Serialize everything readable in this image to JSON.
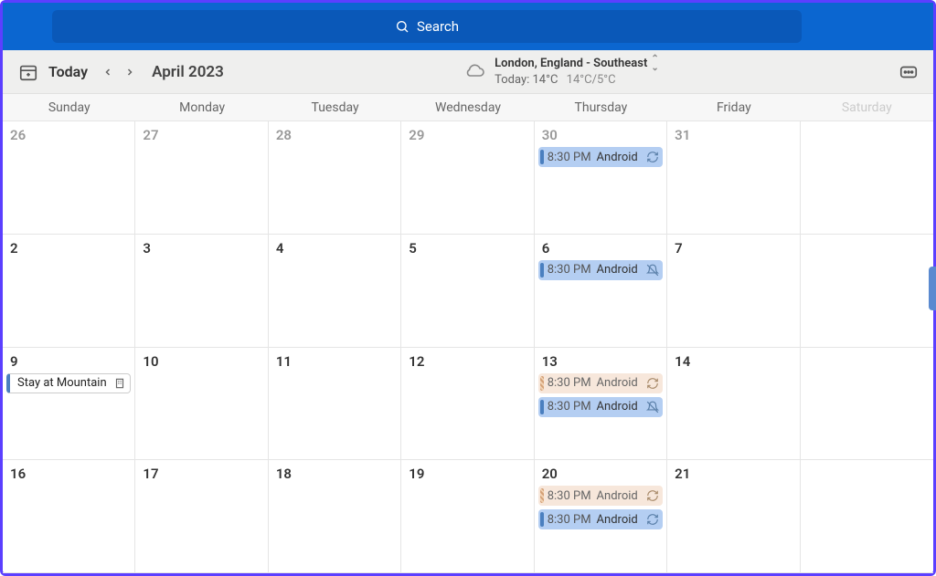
{
  "search": {
    "placeholder": "Search"
  },
  "toolbar": {
    "today_label": "Today",
    "month_label": "April 2023"
  },
  "weather": {
    "location": "London, England - Southeast",
    "today_prefix": "Today:",
    "current": "14°C",
    "high_low": "14°C/5°C"
  },
  "days": [
    "Sunday",
    "Monday",
    "Tuesday",
    "Wednesday",
    "Thursday",
    "Friday",
    "Saturday"
  ],
  "cells": [
    {
      "d": "26",
      "muted": true,
      "events": []
    },
    {
      "d": "27",
      "muted": true,
      "events": []
    },
    {
      "d": "28",
      "muted": true,
      "events": []
    },
    {
      "d": "29",
      "muted": true,
      "events": []
    },
    {
      "d": "30",
      "muted": true,
      "events": [
        {
          "style": "blue",
          "time": "8:30 PM",
          "title": "Android",
          "icon": "recurrence"
        }
      ]
    },
    {
      "d": "31",
      "muted": true,
      "events": []
    },
    {
      "d": "",
      "muted": true,
      "events": []
    },
    {
      "d": "2",
      "events": []
    },
    {
      "d": "3",
      "events": []
    },
    {
      "d": "4",
      "events": []
    },
    {
      "d": "5",
      "events": []
    },
    {
      "d": "6",
      "events": [
        {
          "style": "blue",
          "time": "8:30 PM",
          "title": "Android",
          "icon": "no-reminder"
        }
      ]
    },
    {
      "d": "7",
      "events": []
    },
    {
      "d": "",
      "events": []
    },
    {
      "d": "9",
      "events": [],
      "allday": {
        "title": "Stay at Mountain"
      }
    },
    {
      "d": "10",
      "events": []
    },
    {
      "d": "11",
      "events": []
    },
    {
      "d": "12",
      "events": []
    },
    {
      "d": "13",
      "events": [
        {
          "style": "peach",
          "time": "8:30 PM",
          "title": "Android",
          "icon": "recurrence"
        },
        {
          "style": "blue",
          "time": "8:30 PM",
          "title": "Android",
          "icon": "no-reminder"
        }
      ]
    },
    {
      "d": "14",
      "events": []
    },
    {
      "d": "",
      "events": []
    },
    {
      "d": "16",
      "events": []
    },
    {
      "d": "17",
      "events": []
    },
    {
      "d": "18",
      "events": []
    },
    {
      "d": "19",
      "events": []
    },
    {
      "d": "20",
      "events": [
        {
          "style": "peach",
          "time": "8:30 PM",
          "title": "Android",
          "icon": "recurrence"
        },
        {
          "style": "blue",
          "time": "8:30 PM",
          "title": "Android",
          "icon": "recurrence"
        }
      ]
    },
    {
      "d": "21",
      "events": []
    },
    {
      "d": "",
      "events": []
    }
  ]
}
